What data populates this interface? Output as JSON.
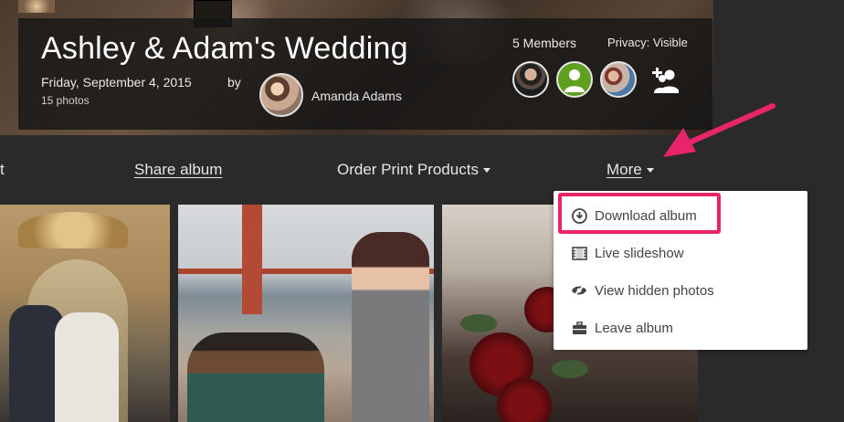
{
  "album": {
    "title": "Ashley & Adam's Wedding",
    "date": "Friday, September 4, 2015",
    "photo_count": "15 photos",
    "by_label": "by",
    "owner_name": "Amanda Adams"
  },
  "members": {
    "count_label": "5 Members",
    "privacy_label": "Privacy: Visible"
  },
  "toolbar": {
    "edit_partial": "t",
    "share": "Share album",
    "order": "Order Print Products",
    "more": "More"
  },
  "menu": {
    "items": [
      {
        "label": "Download album",
        "icon": "download-icon"
      },
      {
        "label": "Live slideshow",
        "icon": "film-icon"
      },
      {
        "label": "View hidden photos",
        "icon": "hidden-eye-icon"
      },
      {
        "label": "Leave album",
        "icon": "briefcase-icon"
      }
    ]
  },
  "colors": {
    "accent": "#e8246a",
    "background": "#2a2a2a",
    "member_green": "#5fa021"
  }
}
